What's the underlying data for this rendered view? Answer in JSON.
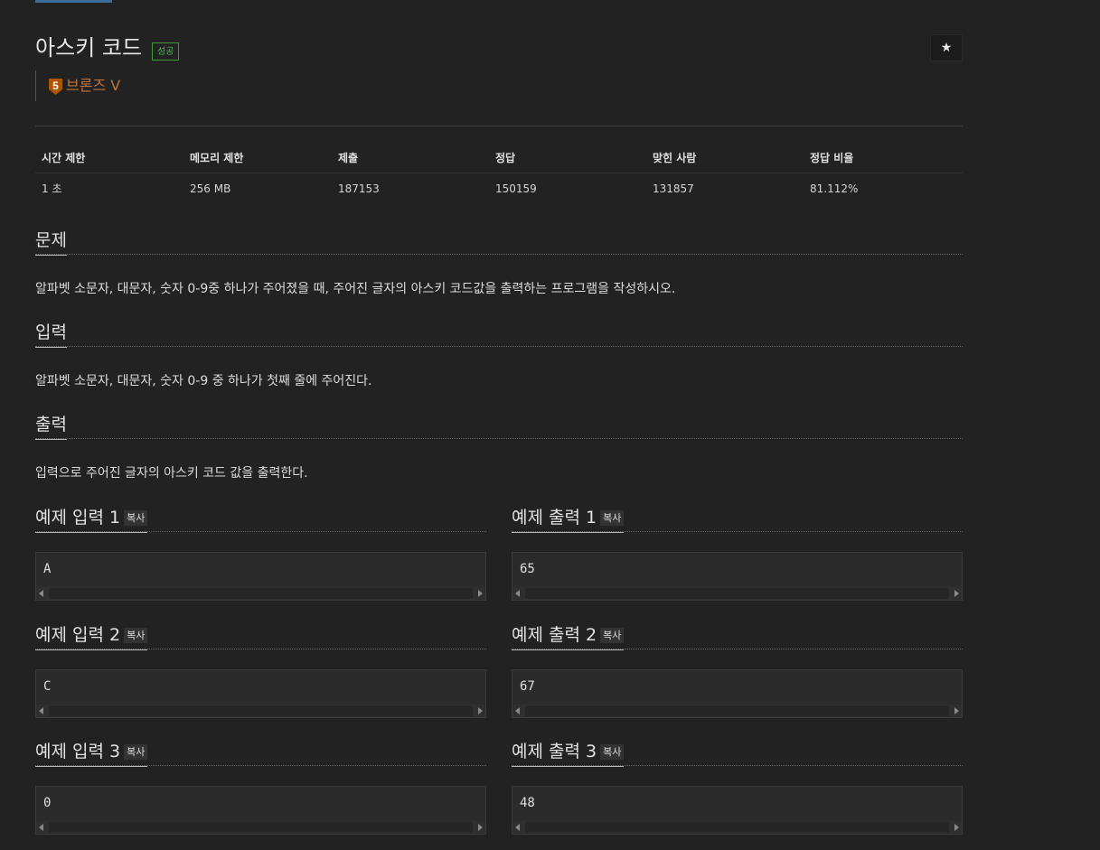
{
  "problem": {
    "title": "아스키 코드",
    "status_badge": "성공",
    "star_icon": "★",
    "tier": {
      "number": "5",
      "label": "브론즈 V",
      "color": "#c1743b"
    }
  },
  "info_table": {
    "headers": [
      "시간 제한",
      "메모리 제한",
      "제출",
      "정답",
      "맞힌 사람",
      "정답 비율"
    ],
    "values": [
      "1 초",
      "256 MB",
      "187153",
      "150159",
      "131857",
      "81.112%"
    ]
  },
  "sections": {
    "description": {
      "heading": "문제",
      "text": "알파벳 소문자, 대문자, 숫자 0-9중 하나가 주어졌을 때, 주어진 글자의 아스키 코드값을 출력하는 프로그램을 작성하시오."
    },
    "input": {
      "heading": "입력",
      "text": "알파벳 소문자, 대문자, 숫자 0-9 중 하나가 첫째 줄에 주어진다."
    },
    "output": {
      "heading": "출력",
      "text": "입력으로 주어진 글자의 아스키 코드 값을 출력한다."
    }
  },
  "copy_label": "복사",
  "samples": [
    {
      "input_heading": "예제 입력 1",
      "input": "A",
      "output_heading": "예제 출력 1",
      "output": "65"
    },
    {
      "input_heading": "예제 입력 2",
      "input": "C",
      "output_heading": "예제 출력 2",
      "output": "67"
    },
    {
      "input_heading": "예제 입력 3",
      "input": "0",
      "output_heading": "예제 출력 3",
      "output": "48"
    }
  ]
}
